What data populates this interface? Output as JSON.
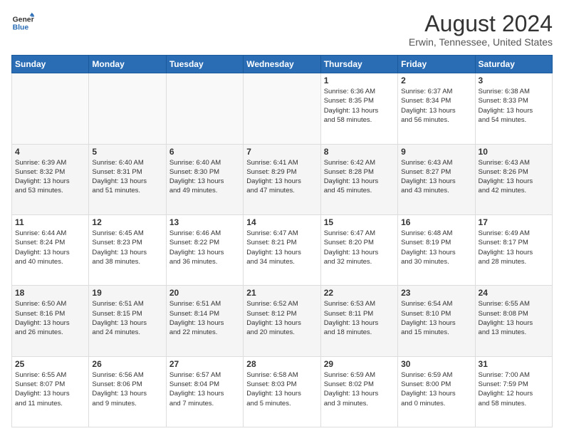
{
  "header": {
    "logo_line1": "General",
    "logo_line2": "Blue",
    "main_title": "August 2024",
    "subtitle": "Erwin, Tennessee, United States"
  },
  "days_of_week": [
    "Sunday",
    "Monday",
    "Tuesday",
    "Wednesday",
    "Thursday",
    "Friday",
    "Saturday"
  ],
  "weeks": [
    [
      {
        "day": "",
        "info": ""
      },
      {
        "day": "",
        "info": ""
      },
      {
        "day": "",
        "info": ""
      },
      {
        "day": "",
        "info": ""
      },
      {
        "day": "1",
        "info": "Sunrise: 6:36 AM\nSunset: 8:35 PM\nDaylight: 13 hours\nand 58 minutes."
      },
      {
        "day": "2",
        "info": "Sunrise: 6:37 AM\nSunset: 8:34 PM\nDaylight: 13 hours\nand 56 minutes."
      },
      {
        "day": "3",
        "info": "Sunrise: 6:38 AM\nSunset: 8:33 PM\nDaylight: 13 hours\nand 54 minutes."
      }
    ],
    [
      {
        "day": "4",
        "info": "Sunrise: 6:39 AM\nSunset: 8:32 PM\nDaylight: 13 hours\nand 53 minutes."
      },
      {
        "day": "5",
        "info": "Sunrise: 6:40 AM\nSunset: 8:31 PM\nDaylight: 13 hours\nand 51 minutes."
      },
      {
        "day": "6",
        "info": "Sunrise: 6:40 AM\nSunset: 8:30 PM\nDaylight: 13 hours\nand 49 minutes."
      },
      {
        "day": "7",
        "info": "Sunrise: 6:41 AM\nSunset: 8:29 PM\nDaylight: 13 hours\nand 47 minutes."
      },
      {
        "day": "8",
        "info": "Sunrise: 6:42 AM\nSunset: 8:28 PM\nDaylight: 13 hours\nand 45 minutes."
      },
      {
        "day": "9",
        "info": "Sunrise: 6:43 AM\nSunset: 8:27 PM\nDaylight: 13 hours\nand 43 minutes."
      },
      {
        "day": "10",
        "info": "Sunrise: 6:43 AM\nSunset: 8:26 PM\nDaylight: 13 hours\nand 42 minutes."
      }
    ],
    [
      {
        "day": "11",
        "info": "Sunrise: 6:44 AM\nSunset: 8:24 PM\nDaylight: 13 hours\nand 40 minutes."
      },
      {
        "day": "12",
        "info": "Sunrise: 6:45 AM\nSunset: 8:23 PM\nDaylight: 13 hours\nand 38 minutes."
      },
      {
        "day": "13",
        "info": "Sunrise: 6:46 AM\nSunset: 8:22 PM\nDaylight: 13 hours\nand 36 minutes."
      },
      {
        "day": "14",
        "info": "Sunrise: 6:47 AM\nSunset: 8:21 PM\nDaylight: 13 hours\nand 34 minutes."
      },
      {
        "day": "15",
        "info": "Sunrise: 6:47 AM\nSunset: 8:20 PM\nDaylight: 13 hours\nand 32 minutes."
      },
      {
        "day": "16",
        "info": "Sunrise: 6:48 AM\nSunset: 8:19 PM\nDaylight: 13 hours\nand 30 minutes."
      },
      {
        "day": "17",
        "info": "Sunrise: 6:49 AM\nSunset: 8:17 PM\nDaylight: 13 hours\nand 28 minutes."
      }
    ],
    [
      {
        "day": "18",
        "info": "Sunrise: 6:50 AM\nSunset: 8:16 PM\nDaylight: 13 hours\nand 26 minutes."
      },
      {
        "day": "19",
        "info": "Sunrise: 6:51 AM\nSunset: 8:15 PM\nDaylight: 13 hours\nand 24 minutes."
      },
      {
        "day": "20",
        "info": "Sunrise: 6:51 AM\nSunset: 8:14 PM\nDaylight: 13 hours\nand 22 minutes."
      },
      {
        "day": "21",
        "info": "Sunrise: 6:52 AM\nSunset: 8:12 PM\nDaylight: 13 hours\nand 20 minutes."
      },
      {
        "day": "22",
        "info": "Sunrise: 6:53 AM\nSunset: 8:11 PM\nDaylight: 13 hours\nand 18 minutes."
      },
      {
        "day": "23",
        "info": "Sunrise: 6:54 AM\nSunset: 8:10 PM\nDaylight: 13 hours\nand 15 minutes."
      },
      {
        "day": "24",
        "info": "Sunrise: 6:55 AM\nSunset: 8:08 PM\nDaylight: 13 hours\nand 13 minutes."
      }
    ],
    [
      {
        "day": "25",
        "info": "Sunrise: 6:55 AM\nSunset: 8:07 PM\nDaylight: 13 hours\nand 11 minutes."
      },
      {
        "day": "26",
        "info": "Sunrise: 6:56 AM\nSunset: 8:06 PM\nDaylight: 13 hours\nand 9 minutes."
      },
      {
        "day": "27",
        "info": "Sunrise: 6:57 AM\nSunset: 8:04 PM\nDaylight: 13 hours\nand 7 minutes."
      },
      {
        "day": "28",
        "info": "Sunrise: 6:58 AM\nSunset: 8:03 PM\nDaylight: 13 hours\nand 5 minutes."
      },
      {
        "day": "29",
        "info": "Sunrise: 6:59 AM\nSunset: 8:02 PM\nDaylight: 13 hours\nand 3 minutes."
      },
      {
        "day": "30",
        "info": "Sunrise: 6:59 AM\nSunset: 8:00 PM\nDaylight: 13 hours\nand 0 minutes."
      },
      {
        "day": "31",
        "info": "Sunrise: 7:00 AM\nSunset: 7:59 PM\nDaylight: 12 hours\nand 58 minutes."
      }
    ]
  ]
}
